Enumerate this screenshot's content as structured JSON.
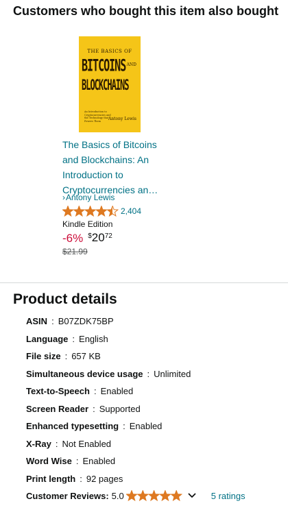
{
  "recommendations": {
    "section_title": "Customers who bought this item also bought",
    "items": [
      {
        "cover": {
          "top_text": "THE BASICS OF",
          "big_text_1": "BITCOINS",
          "and_text": "AND",
          "big_text_2": "BLOCKCHAINS",
          "subtitle_text": "An Introduction to Cryptocurrencies and the Technology that Powers Them",
          "author_text": "Antony Lewis",
          "color": "#f5c518"
        },
        "title": "The Basics of Bitcoins and Blockchains: An Introduction to Cryptocurrencies an…",
        "author": "Antony Lewis",
        "author_chevron": "›",
        "rating_stars": 4.5,
        "rating_count": "2,404",
        "format": "Kindle Edition",
        "discount": "-6%",
        "price_symbol": "$",
        "price_whole": "20",
        "price_fraction": "72",
        "list_price": "$21.99"
      }
    ]
  },
  "product_details": {
    "title": "Product details",
    "separator": ":",
    "rows": [
      {
        "label": "ASIN",
        "value": "B07ZDK75BP"
      },
      {
        "label": "Language",
        "value": "English"
      },
      {
        "label": "File size",
        "value": "657 KB"
      },
      {
        "label": "Simultaneous device usage",
        "value": "Unlimited"
      },
      {
        "label": "Text-to-Speech",
        "value": "Enabled"
      },
      {
        "label": "Screen Reader",
        "value": "Supported"
      },
      {
        "label": "Enhanced typesetting",
        "value": "Enabled"
      },
      {
        "label": "X-Ray",
        "value": "Not Enabled"
      },
      {
        "label": "Word Wise",
        "value": "Enabled"
      },
      {
        "label": "Print length",
        "value": "92 pages"
      }
    ],
    "customer_reviews": {
      "label": "Customer Reviews:",
      "score": "5.0",
      "stars": 5,
      "ratings_link": "5 ratings"
    }
  },
  "colors": {
    "link": "#007185",
    "star": "#de7921",
    "discount": "#cc0c39",
    "muted": "#565959",
    "divider": "#d5d9d9"
  }
}
